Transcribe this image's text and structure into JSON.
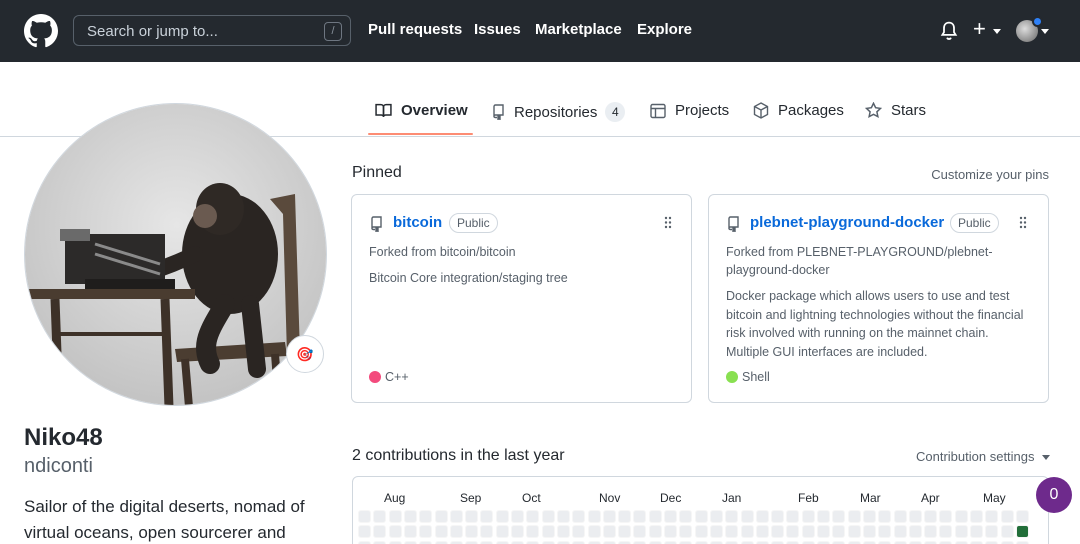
{
  "header": {
    "search_placeholder": "Search or jump to...",
    "search_shortcut": "/",
    "nav": [
      "Pull requests",
      "Issues",
      "Marketplace",
      "Explore"
    ],
    "plus": "+"
  },
  "tabs": [
    {
      "label": "Overview",
      "active": true
    },
    {
      "label": "Repositories",
      "count": "4"
    },
    {
      "label": "Projects"
    },
    {
      "label": "Packages"
    },
    {
      "label": "Stars"
    }
  ],
  "profile": {
    "name": "Niko48",
    "login": "ndiconti",
    "bio": "Sailor of the digital deserts, nomad of virtual oceans, open sourcerer and",
    "status_emoji": "🎯"
  },
  "pinned": {
    "title": "Pinned",
    "customize": "Customize your pins",
    "cards": [
      {
        "name": "bitcoin",
        "visibility": "Public",
        "forked_from": "Forked from bitcoin/bitcoin",
        "description": "Bitcoin Core integration/staging tree",
        "language": "C++",
        "language_color": "#f34b7d"
      },
      {
        "name": "plebnet-playground-docker",
        "visibility": "Public",
        "forked_from": "Forked from PLEBNET-PLAYGROUND/plebnet-playground-docker",
        "description": "Docker package which allows users to use and test bitcoin and lightning technologies without the financial risk involved with running on the mainnet chain. Multiple GUI interfaces are included.",
        "language": "Shell",
        "language_color": "#89e051"
      }
    ]
  },
  "contributions": {
    "title": "2 contributions in the last year",
    "settings": "Contribution settings",
    "months": [
      "Aug",
      "Sep",
      "Oct",
      "Nov",
      "Dec",
      "Jan",
      "Feb",
      "Mar",
      "Apr",
      "May"
    ],
    "empty_color": "#ebedf0",
    "active_color": "#216e39"
  },
  "fab_count": "0"
}
